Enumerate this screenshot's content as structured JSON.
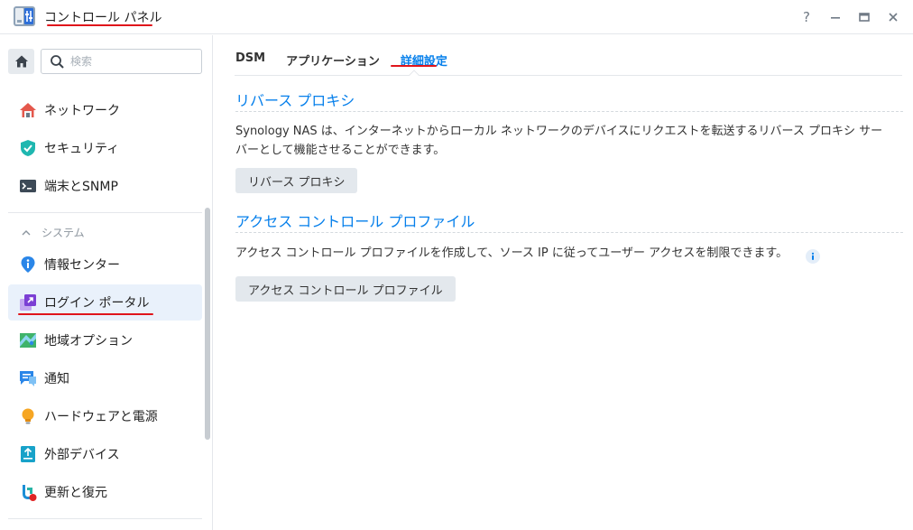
{
  "window": {
    "title": "コントロール パネル",
    "controls": {
      "help": "?",
      "minimize": "—",
      "maximize": "▭",
      "close": "✕"
    }
  },
  "sidebar": {
    "search_placeholder": "検索",
    "items_top": [
      {
        "label": "ネットワーク",
        "icon": "network-icon"
      },
      {
        "label": "セキュリティ",
        "icon": "security-shield-icon"
      },
      {
        "label": "端末とSNMP",
        "icon": "terminal-icon"
      }
    ],
    "section": {
      "label": "システム",
      "icon": "chevron-up-icon"
    },
    "items_system": [
      {
        "label": "情報センター",
        "icon": "info-center-icon"
      },
      {
        "label": "ログイン ポータル",
        "icon": "login-portal-icon",
        "active": true
      },
      {
        "label": "地域オプション",
        "icon": "regional-options-icon"
      },
      {
        "label": "通知",
        "icon": "notification-icon"
      },
      {
        "label": "ハードウェアと電源",
        "icon": "hardware-power-icon"
      },
      {
        "label": "外部デバイス",
        "icon": "external-device-icon"
      },
      {
        "label": "更新と復元",
        "icon": "update-restore-icon"
      }
    ]
  },
  "main": {
    "tabs": [
      {
        "label": "DSM"
      },
      {
        "label": "アプリケーション"
      },
      {
        "label": "詳細設定",
        "active": true
      }
    ],
    "reverse_proxy": {
      "title": "リバース プロキシ",
      "description_line1": "Synology NAS は、インターネットからローカル ネットワークのデバイスにリクエストを転送するリバース プロキシ サー",
      "description_line2": "バーとして機能させることができます。",
      "button": "リバース プロキシ"
    },
    "access_control": {
      "title": "アクセス コントロール プロファイル",
      "description": "アクセス コントロール プロファイルを作成して、ソース IP に従ってユーザー アクセスを制限できます。",
      "button": "アクセス コントロール プロファイル"
    }
  },
  "colors": {
    "accent": "#057feb",
    "annotation_red": "#e0151b",
    "active_bg": "#e9f1fb"
  }
}
